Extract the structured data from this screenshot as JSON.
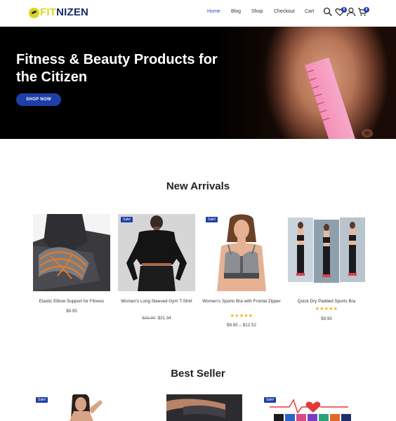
{
  "header": {
    "logo": {
      "part1": "FIT",
      "part2": "NIZEN"
    },
    "nav": [
      {
        "label": "Home",
        "active": true
      },
      {
        "label": "Blog",
        "active": false
      },
      {
        "label": "Shop",
        "active": false
      },
      {
        "label": "Checkout",
        "active": false
      },
      {
        "label": "Cart",
        "active": false
      }
    ],
    "icons": [
      "search-icon",
      "heart-icon",
      "user-icon",
      "cart-icon"
    ],
    "wishlist_count": "0",
    "cart_count": "0"
  },
  "hero": {
    "title": "Fitness & Beauty Products for the Citizen",
    "button": "SHOP NOW"
  },
  "new_arrivals": {
    "title": "New Arrivals",
    "products": [
      {
        "name": "Elastic Elbow Support for Fitness",
        "price": "$9.95",
        "sale": "",
        "old_price": "",
        "rating": ""
      },
      {
        "name": "Women’s Long Sleeved Gym T-Shirt",
        "price": "$31.34",
        "sale": "Sale!",
        "old_price": "$33.90",
        "rating": ""
      },
      {
        "name": "Women’s Sports Bra with Frontal Zipper",
        "price": "$9.95 – $12.52",
        "sale": "Sale!",
        "old_price": "",
        "rating": "★★★★★"
      },
      {
        "name": "Quick Dry Padded Sports Bra",
        "price": "$9.95",
        "sale": "",
        "old_price": "",
        "rating": "★★★★★"
      }
    ]
  },
  "best_seller": {
    "title": "Best Seller",
    "products": [
      {
        "sale": "Sale!"
      },
      {
        "sale": ""
      },
      {
        "sale": "Sale!"
      }
    ]
  },
  "colors": {
    "accent": "#1e3ea8",
    "logo_yellow": "#d7d61e",
    "logo_navy": "#1a2a6c",
    "star": "#f2b01e"
  }
}
